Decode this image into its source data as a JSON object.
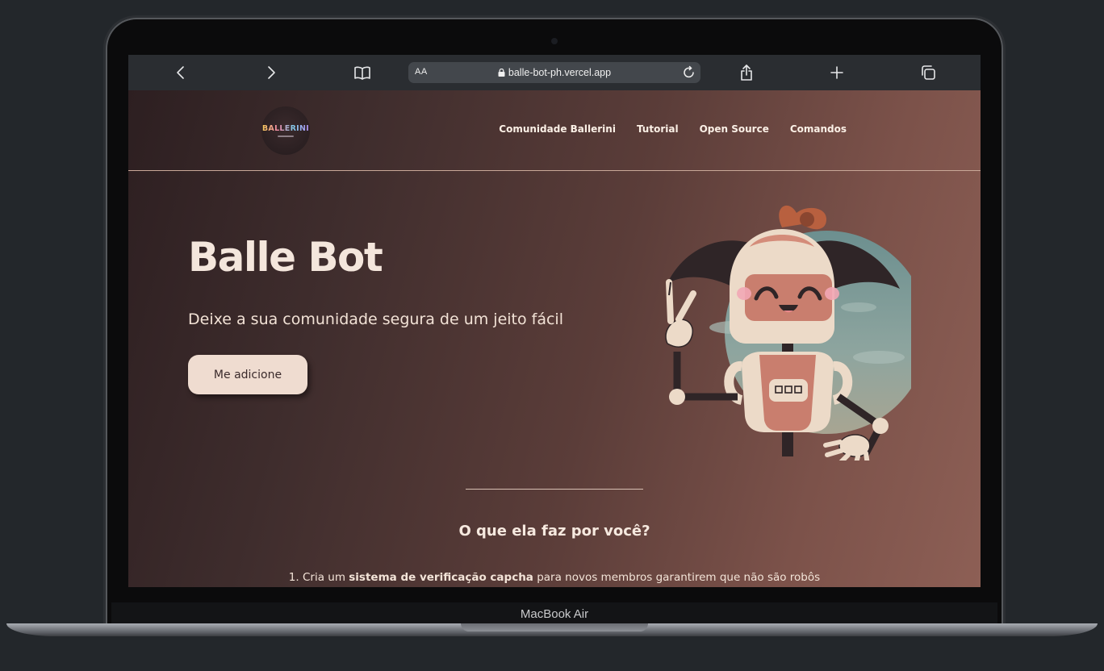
{
  "device": {
    "label": "MacBook Air"
  },
  "browser": {
    "text_size_label": "AA",
    "url": "balle-bot-ph.vercel.app",
    "icons": [
      "chevron-left-icon",
      "chevron-right-icon",
      "book-icon",
      "lock-icon",
      "reload-icon",
      "share-icon",
      "plus-icon",
      "tabs-icon"
    ]
  },
  "site": {
    "logo_text": "BALLERINI",
    "nav": [
      "Comunidade Ballerini",
      "Tutorial",
      "Open Source",
      "Comandos"
    ],
    "hero": {
      "title": "Balle Bot",
      "subtitle": "Deixe a sua comunidade segura de um jeito fácil",
      "cta": "Me adicione"
    },
    "section": {
      "title": "O que ela faz por você?",
      "features": [
        {
          "prefix": "1. Cria um ",
          "bold": "sistema de verificação capcha",
          "suffix": " para novos membros garantirem que não são robôs"
        }
      ]
    }
  },
  "colors": {
    "frame_bg": "#23272b",
    "toolbar": "#2a2d31",
    "page_gradient_start": "#2d1f21",
    "page_gradient_end": "#8d5f55",
    "button_bg": "#efdcd0",
    "text": "#f3e4d8"
  }
}
